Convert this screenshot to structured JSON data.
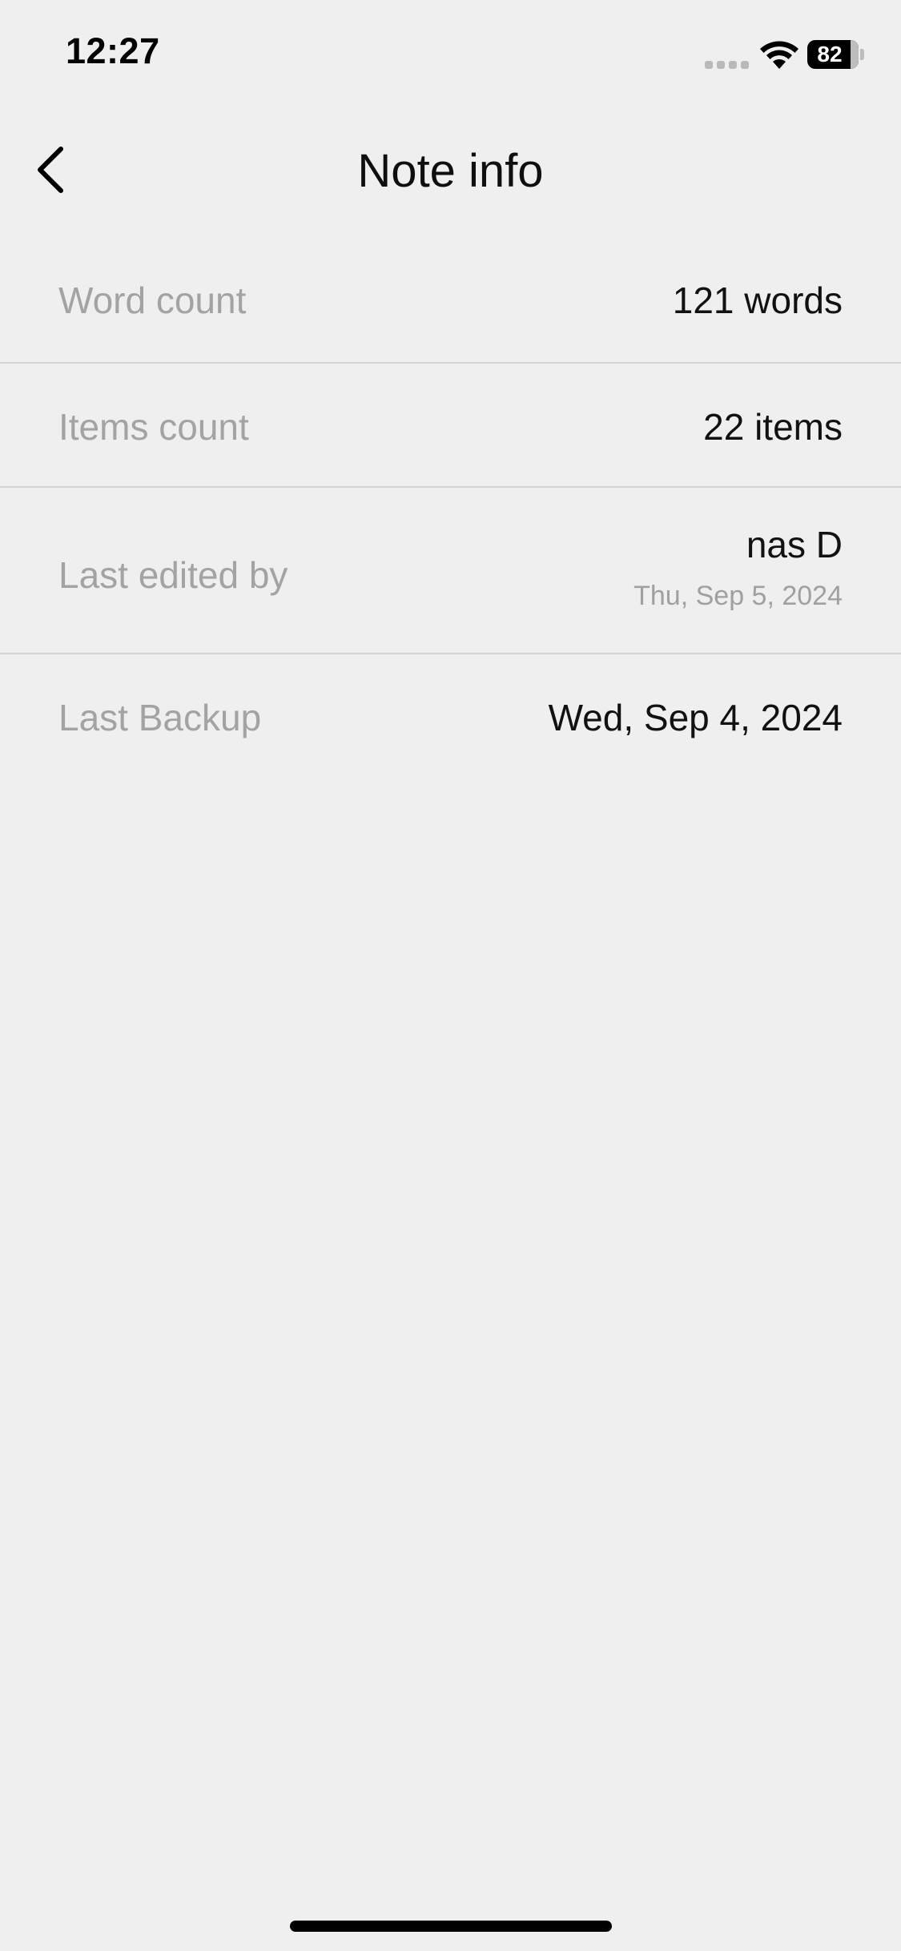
{
  "status_bar": {
    "time": "12:27",
    "battery_level": "82",
    "icons": [
      "signal-dots-icon",
      "wifi-icon",
      "battery-icon"
    ]
  },
  "nav": {
    "title": "Note info",
    "back_icon": "chevron-left-icon"
  },
  "info_rows": [
    {
      "label": "Word count",
      "value": "121 words"
    },
    {
      "label": "Items count",
      "value": "22 items"
    },
    {
      "label": "Last edited by",
      "value": "nas D",
      "subvalue": "Thu, Sep 5, 2024"
    },
    {
      "label": "Last Backup",
      "value": "Wed, Sep 4, 2024"
    }
  ],
  "colors": {
    "background": "#efefef",
    "label": "#a3a3a3",
    "value": "#111111",
    "divider": "#d3d3d3"
  }
}
